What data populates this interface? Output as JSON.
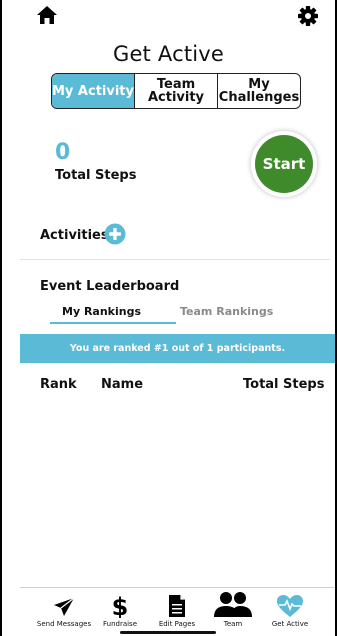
{
  "header": {
    "home_icon": "home-icon",
    "settings_icon": "gear-icon"
  },
  "page": {
    "title": "Get Active"
  },
  "tabs": [
    {
      "label": "My Activity",
      "active": true
    },
    {
      "label": "Team\nActivity",
      "active": false
    },
    {
      "label": "My\nChallenges",
      "active": false
    }
  ],
  "steps": {
    "count": "0",
    "label": "Total Steps"
  },
  "start_button": {
    "label": "Start",
    "color": "#3f8a2a"
  },
  "activities": {
    "label": "Activities",
    "add_icon": "plus-circle-icon"
  },
  "leaderboard": {
    "title": "Event Leaderboard",
    "tabs": [
      {
        "label": "My Rankings",
        "active": true
      },
      {
        "label": "Team Rankings",
        "active": false
      }
    ],
    "banner": "You are ranked #1 out of 1 participants.",
    "columns": [
      "Rank",
      "Name",
      "Total Steps"
    ]
  },
  "bottom_nav": [
    {
      "label": "Send Messages",
      "icon": "paper-plane-icon",
      "active": false
    },
    {
      "label": "Fundraise",
      "icon": "dollar-icon",
      "active": false
    },
    {
      "label": "Edit Pages",
      "icon": "document-icon",
      "active": false
    },
    {
      "label": "Team",
      "icon": "people-icon",
      "active": false
    },
    {
      "label": "Get Active",
      "icon": "heart-pulse-icon",
      "active": true
    }
  ],
  "colors": {
    "accent": "#5bbad6",
    "start": "#3f8a2a",
    "text": "#111111"
  }
}
